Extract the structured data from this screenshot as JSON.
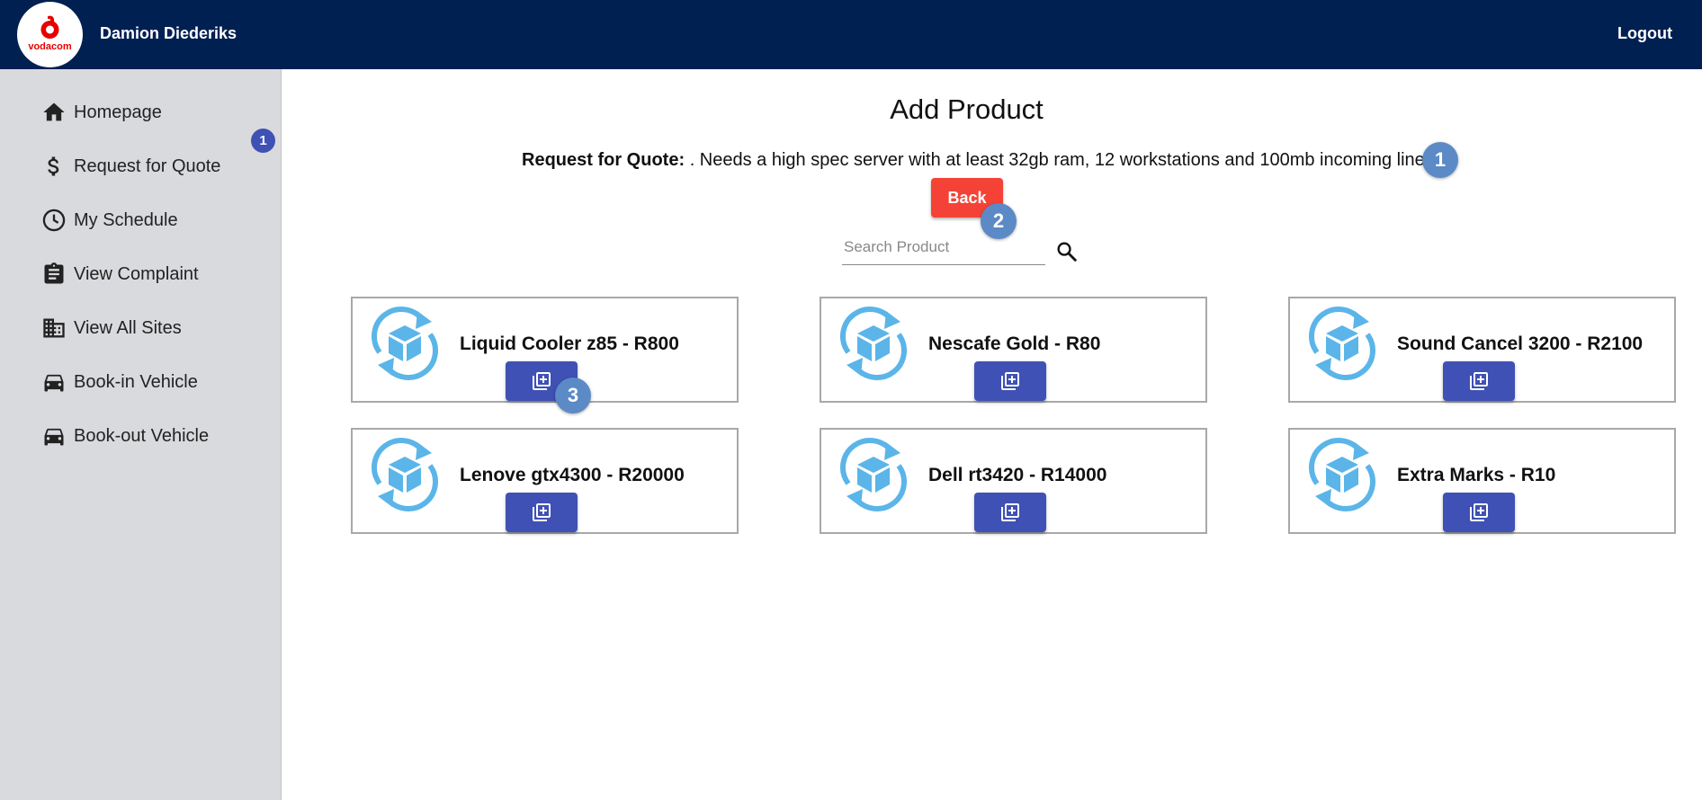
{
  "header": {
    "logo_text": "vodacom",
    "user_name": "Damion Diederiks",
    "logout_label": "Logout"
  },
  "sidebar": {
    "badge": "1",
    "items": [
      {
        "label": "Homepage",
        "icon": "home-icon"
      },
      {
        "label": "Request for Quote",
        "icon": "dollar-icon"
      },
      {
        "label": "My Schedule",
        "icon": "clock-icon"
      },
      {
        "label": "View Complaint",
        "icon": "clipboard-icon"
      },
      {
        "label": "View All Sites",
        "icon": "building-icon"
      },
      {
        "label": "Book-in Vehicle",
        "icon": "car-icon"
      },
      {
        "label": "Book-out Vehicle",
        "icon": "car-icon"
      }
    ]
  },
  "main": {
    "title": "Add Product",
    "rfq_label": "Request for Quote:",
    "rfq_text": ". Needs a high spec server with at least 32gb ram, 12 workstations and 100mb incoming line",
    "back_label": "Back",
    "search_placeholder": "Search Product",
    "products": [
      {
        "title": "Liquid Cooler z85 - R800"
      },
      {
        "title": "Nescafe Gold - R80"
      },
      {
        "title": "Sound Cancel 3200 - R2100"
      },
      {
        "title": "Lenove gtx4300 - R20000"
      },
      {
        "title": "Dell rt3420 - R14000"
      },
      {
        "title": "Extra Marks - R10"
      }
    ]
  },
  "steps": [
    "1",
    "2",
    "3"
  ],
  "colors": {
    "topbar": "#002052",
    "sidebar": "#d9dadd",
    "primary": "#3f51b5",
    "danger": "#f44336",
    "step": "#5b8ac6",
    "product_icon": "#5bb5e8"
  }
}
